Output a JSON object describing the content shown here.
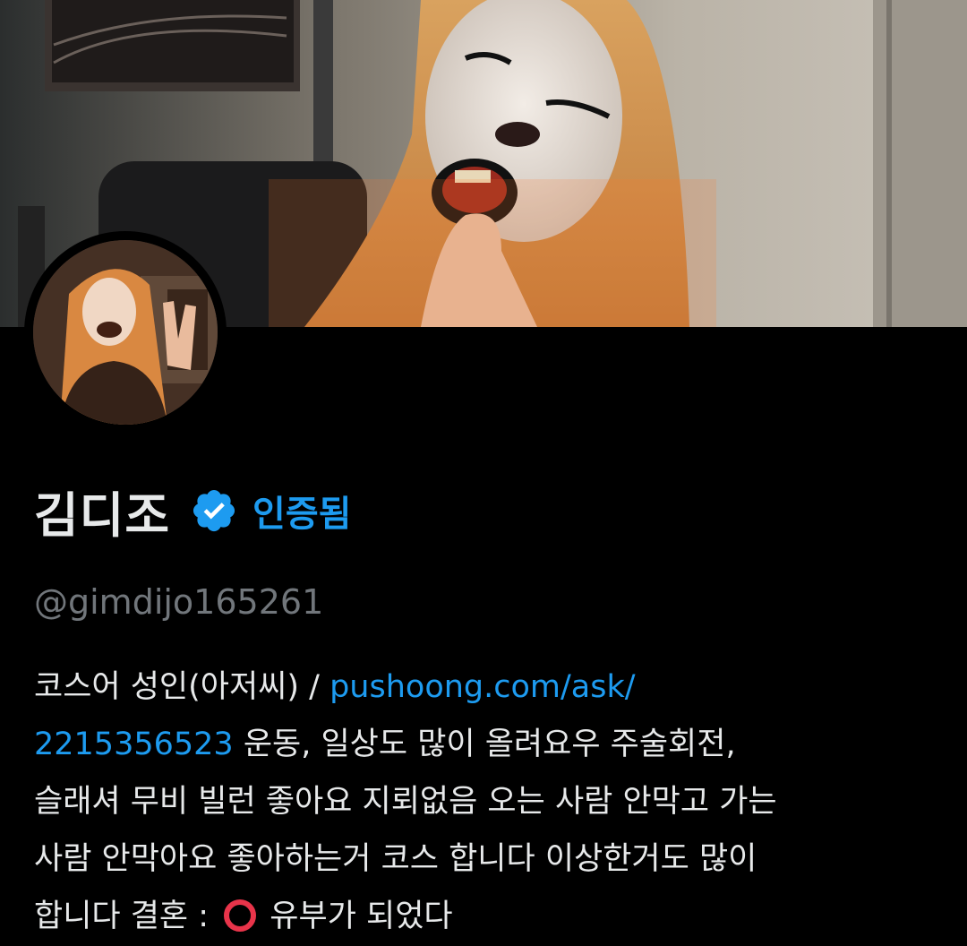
{
  "profile": {
    "display_name": "김디조",
    "verified_label": "인증됨",
    "handle": "@gimdijo165261",
    "colors": {
      "background": "#000000",
      "text": "#e7e9ea",
      "secondary_text": "#71767b",
      "link": "#1d9bf0",
      "verified_badge": "#1d9bf0"
    }
  },
  "bio": {
    "line1_text": "코스어 성인(아저씨) / ",
    "line1_link": "pushoong.com/ask/",
    "line2_link": "2215356523",
    "line2_text": "  운동, 일상도 많이 올려요우  주술회전,",
    "line3_text": "슬래셔 무비 빌런 좋아요 지뢰없음 오는 사람 안막고 가는",
    "line4_text": "사람 안막아요  좋아하는거 코스 합니다 이상한거도 많이",
    "line5_before": "합니다  결혼 : ",
    "line5_emoji": "heavy-large-circle-emoji",
    "line5_after": " 유부가 되었다"
  },
  "icons": {
    "verified": "verified-badge-icon"
  }
}
